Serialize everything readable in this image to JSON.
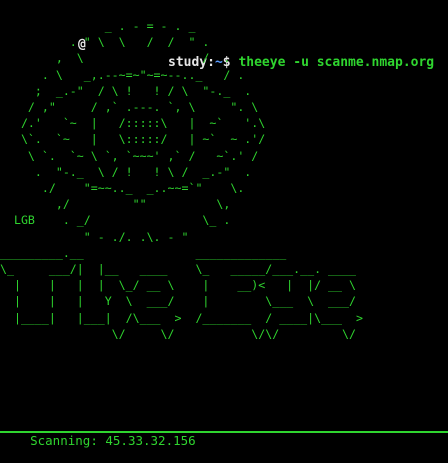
{
  "prompt": {
    "user": "",
    "at": "@",
    "host": "study",
    "separator": ":",
    "path": "~",
    "dollar": "$",
    "command": "theeye -u scanme.nmap.org"
  },
  "banner_art": "               _ . - = - . _\n          . \" \\  \\   /  /  \" .\n        ,  \\                 /  .\n      . \\   _,.--~=~\"~=~--.._   / .\n     ;  _.-\"  / \\ !   ! / \\  \"-._  .\n    / ,\"     / ,` .---. `, \\     \". \\\n   /.'   `~  |   /:::::\\   |  ~`   '.\\\n   \\`.  `~   |   \\:::::/   | ~`  ~ .'/\n    \\ `.  `~ \\ `, `~~~' ,` /   ~`.' /\n     .  \"-._  \\ / !   ! \\ /  _.-\"  .\n      ./    \"=~~.._  _..~~=`\"    \\.\n        ,/         \"\"          \\,\n  LGB    . _/                \\_ .\n            \" - ./. .\\. - \"",
  "title_art": "_________.__                _____________\n\\_     ___/|  |__   ____    \\_   _____/___.__. ____\n  |    |   |  |  \\_/ __ \\    |    __)<   |  |/ __ \\\n  |    |   |   Y  \\  ___/    |        \\___  \\  ___/\n  |____|   |___|  /\\___  >  /_______  / ____|\\___  >\n                \\/     \\/           \\/\\/         \\/",
  "status": {
    "text": "Scanning: 45.33.32.156"
  }
}
